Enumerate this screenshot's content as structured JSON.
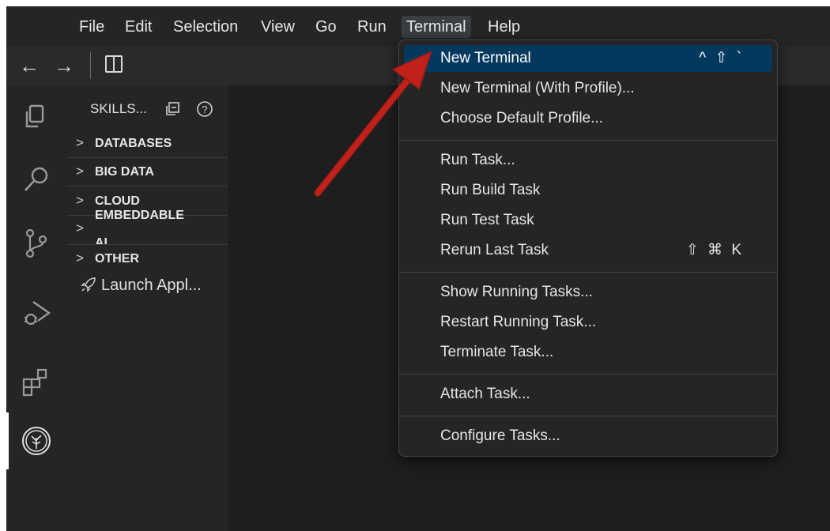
{
  "menubar": {
    "items": [
      "File",
      "Edit",
      "Selection",
      "View",
      "Go",
      "Run",
      "Terminal",
      "Help"
    ]
  },
  "toolbar": {
    "back_glyph": "←",
    "forward_glyph": "→"
  },
  "activity_bar": {
    "icons": [
      "explorer-icon",
      "search-icon",
      "source-control-icon",
      "run-debug-icon",
      "extensions-icon",
      "skills-tree-icon"
    ]
  },
  "sidebar": {
    "title": "SKILLS...",
    "sections": [
      {
        "label": "DATABASES"
      },
      {
        "label": "BIG DATA"
      },
      {
        "label": "CLOUD"
      },
      {
        "label": "EMBEDDABLE"
      },
      {
        "label": "AI"
      },
      {
        "label": "OTHER"
      }
    ],
    "launch_label": "Launch Appl..."
  },
  "terminal_menu": {
    "items": [
      {
        "label": "New Terminal",
        "shortcut": "^ ⇧ `"
      },
      {
        "label": "New Terminal (With Profile)...",
        "shortcut": ""
      },
      {
        "label": "Choose Default Profile...",
        "shortcut": ""
      },
      {
        "label": "Run Task...",
        "shortcut": ""
      },
      {
        "label": "Run Build Task",
        "shortcut": ""
      },
      {
        "label": "Run Test Task",
        "shortcut": ""
      },
      {
        "label": "Rerun Last Task",
        "shortcut": "⇧ ⌘ K"
      },
      {
        "label": "Show Running Tasks...",
        "shortcut": ""
      },
      {
        "label": "Restart Running Task...",
        "shortcut": ""
      },
      {
        "label": "Terminate Task...",
        "shortcut": ""
      },
      {
        "label": "Attach Task...",
        "shortcut": ""
      },
      {
        "label": "Configure Tasks...",
        "shortcut": ""
      }
    ]
  },
  "colors": {
    "highlight": "#04395e",
    "arrow": "#c0211b",
    "background": "#1f1f1f"
  }
}
